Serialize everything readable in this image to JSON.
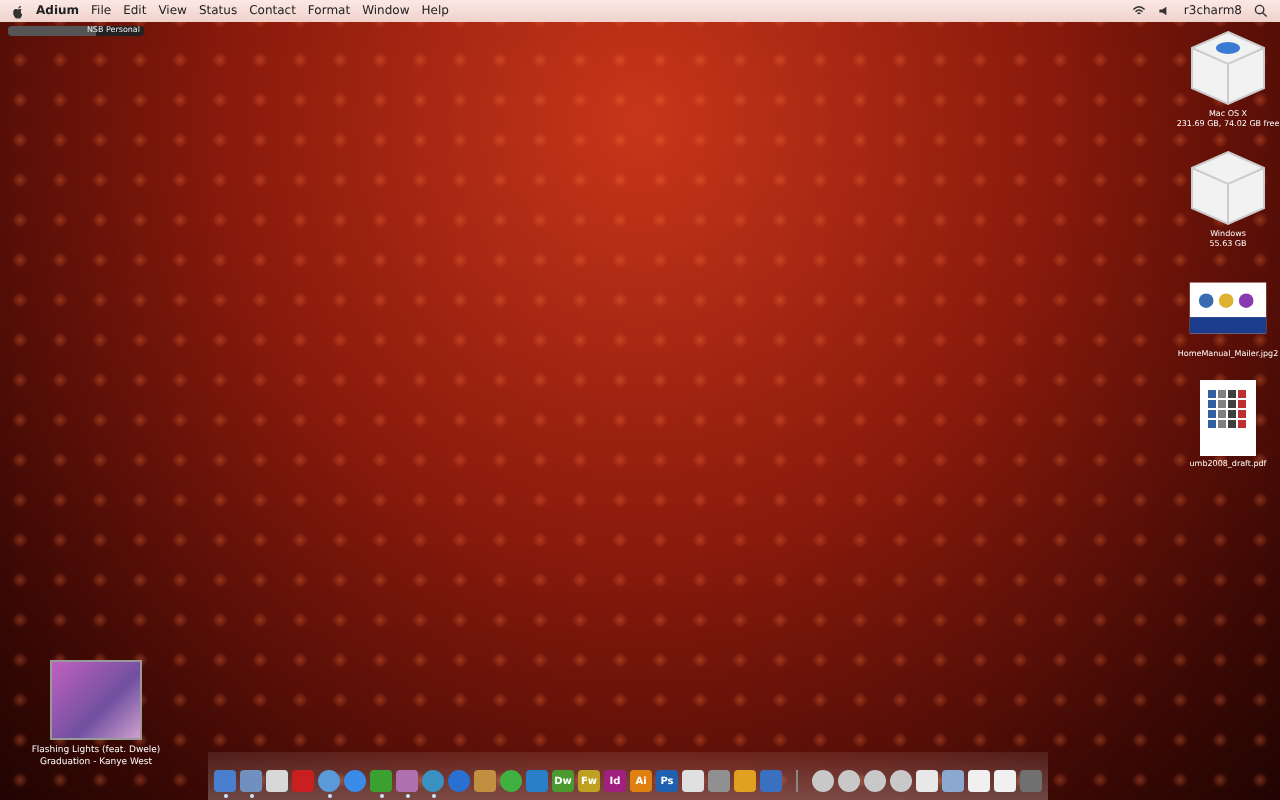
{
  "menubar": {
    "app": "Adium",
    "menus": [
      "File",
      "Edit",
      "View",
      "Status",
      "Contact",
      "Format",
      "Window",
      "Help"
    ],
    "user": "r3charm8"
  },
  "status_strip": {
    "label": "NSB Personal",
    "level": 0.65
  },
  "desktop_icons": [
    {
      "kind": "drive",
      "label": "Mac OS X",
      "detail": "231.69 GB, 74.02 GB free"
    },
    {
      "kind": "drive",
      "label": "Windows",
      "detail": "55.63 GB"
    },
    {
      "kind": "document",
      "label": "HomeManual_Mailer.jpg2"
    },
    {
      "kind": "pdf",
      "label": "umb2008_draft.pdf"
    }
  ],
  "now_playing": {
    "title": "Flashing Lights (feat. Dwele)",
    "subtitle": "Graduation - Kanye West"
  },
  "dock": [
    {
      "kind": "tile",
      "color": "#4a7fd0",
      "running": true
    },
    {
      "kind": "tile",
      "color": "#7090c0",
      "running": true
    },
    {
      "kind": "tile",
      "color": "#d8d8d8",
      "running": false
    },
    {
      "kind": "tile",
      "color": "#c82020",
      "running": false
    },
    {
      "kind": "round",
      "color": "#5a9ad8",
      "running": true
    },
    {
      "kind": "round",
      "color": "#3a8ae8",
      "running": false
    },
    {
      "kind": "tile",
      "color": "#3aa030",
      "running": true
    },
    {
      "kind": "tile",
      "color": "#b070b0",
      "running": true
    },
    {
      "kind": "round",
      "color": "#3a90c0",
      "running": true
    },
    {
      "kind": "round",
      "color": "#2a70d0",
      "running": false
    },
    {
      "kind": "tile",
      "color": "#c09040",
      "running": false
    },
    {
      "kind": "round",
      "color": "#40b040",
      "running": false
    },
    {
      "kind": "tile",
      "color": "#2a80c8",
      "running": false
    },
    {
      "kind": "letter",
      "label": "Dw",
      "color": "#4a9a30",
      "running": false
    },
    {
      "kind": "letter",
      "label": "Fw",
      "color": "#c0a020",
      "running": false
    },
    {
      "kind": "letter",
      "label": "Id",
      "color": "#a02080",
      "running": false
    },
    {
      "kind": "letter",
      "label": "Ai",
      "color": "#e08010",
      "running": false
    },
    {
      "kind": "letter",
      "label": "Ps",
      "color": "#2060b0",
      "running": false
    },
    {
      "kind": "tile",
      "color": "#e0e0e0",
      "running": false
    },
    {
      "kind": "tile",
      "color": "#909090",
      "running": false
    },
    {
      "kind": "tile",
      "color": "#e0a020",
      "running": false
    },
    {
      "kind": "tile",
      "color": "#3a70c0",
      "running": false
    },
    {
      "kind": "separator",
      "color": "#888888",
      "running": false
    },
    {
      "kind": "round",
      "color": "#c8c8c8",
      "running": false
    },
    {
      "kind": "round",
      "color": "#c8c8c8",
      "running": false
    },
    {
      "kind": "round",
      "color": "#c8c8c8",
      "running": false
    },
    {
      "kind": "round",
      "color": "#c8c8c8",
      "running": false
    },
    {
      "kind": "tile",
      "color": "#e8e8e8",
      "running": false
    },
    {
      "kind": "tile",
      "color": "#8aa8d0",
      "running": false
    },
    {
      "kind": "tile",
      "color": "#f0f0f0",
      "running": false
    },
    {
      "kind": "tile",
      "color": "#f0f0f0",
      "running": false
    },
    {
      "kind": "tile",
      "color": "#707070",
      "running": false
    }
  ]
}
